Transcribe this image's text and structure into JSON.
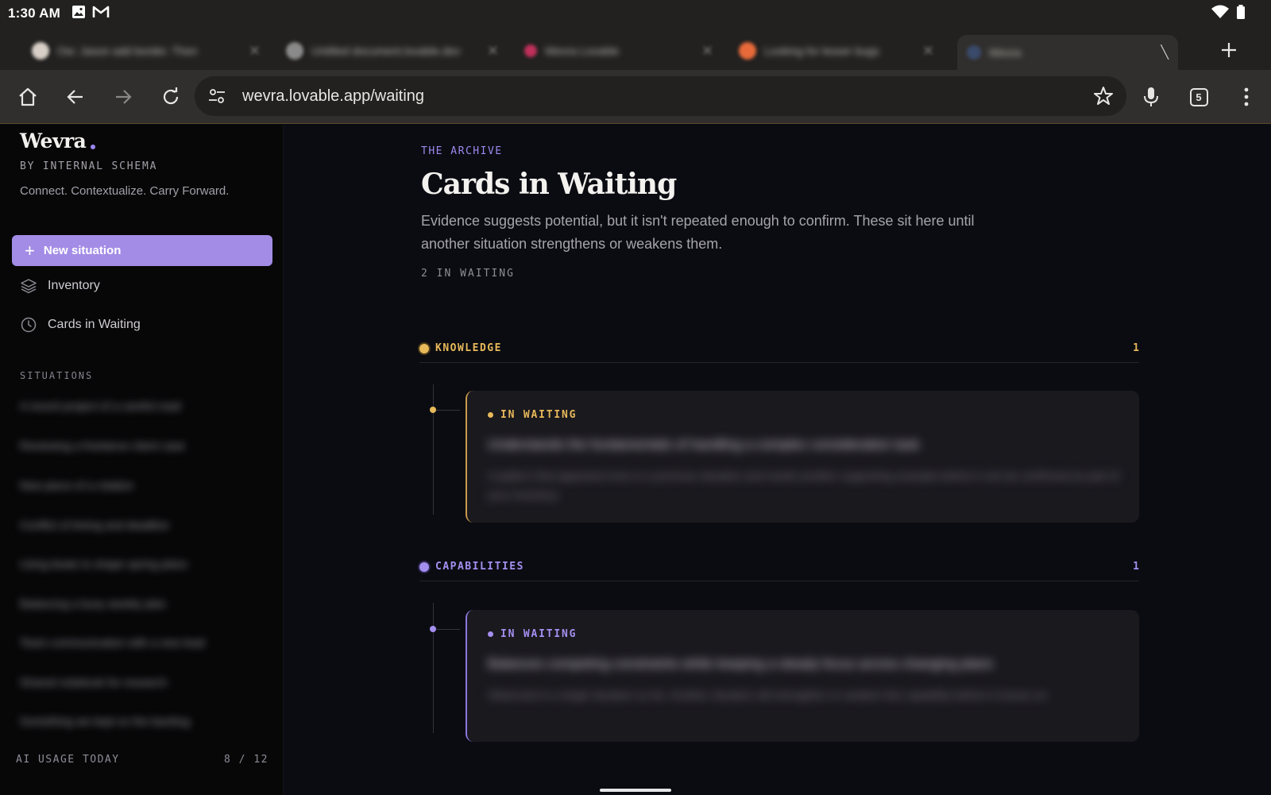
{
  "status_bar": {
    "time": "1:30 AM"
  },
  "browser": {
    "url": "wevra.lovable.app/waiting",
    "tab_count": "5",
    "tabs": [
      {
        "title": "Ow: Jason add border. Then",
        "favicon_color": "#d8d0c8"
      },
      {
        "title": "Untitled document.lovable.dev",
        "favicon_color": "#8a8a8a"
      },
      {
        "title": "Wevra Lovable",
        "favicon_color": "#c0305a"
      },
      {
        "title": "Looking for lesser bugs",
        "favicon_color": "#e86a3a"
      },
      {
        "title": "Wevra",
        "favicon_color": "#3a4a6a"
      }
    ]
  },
  "sidebar": {
    "brand": "Wevra",
    "byline": "BY INTERNAL SCHEMA",
    "tagline": "Connect. Contextualize. Carry Forward.",
    "new_button": "New situation",
    "nav": [
      {
        "label": "Inventory",
        "icon": "layers-icon"
      },
      {
        "label": "Cards in Waiting",
        "icon": "clock-icon"
      }
    ],
    "situations_label": "SITUATIONS",
    "situations": [
      "A recent project of a careful read",
      "Reviewing a freelance client case",
      "New piece of a rotation",
      "Conflict of timing and deadline",
      "Using beats to shape spring plans",
      "Balancing a busy weekly plan",
      "Team communication with a new lead",
      "Shared notebook for research",
      "Something we kept on the backlog"
    ],
    "usage_label": "AI USAGE TODAY",
    "usage_value": "8 / 12"
  },
  "main": {
    "eyebrow": "THE ARCHIVE",
    "title": "Cards in Waiting",
    "description": "Evidence suggests potential, but it isn't repeated enough to confirm. These sit here until another situation strengthens or weakens them.",
    "count_label": "2 IN WAITING",
    "groups": [
      {
        "name": "KNOWLEDGE",
        "count": "1",
        "color": "#e8b95a",
        "card": {
          "status": "IN WAITING",
          "title": "Understands the fundamentals of handling a complex consideration task",
          "body": "A pattern that appeared once in a previous situation and needs another supporting example before it can be confirmed as part of your inventory."
        }
      },
      {
        "name": "CAPABILITIES",
        "count": "1",
        "color": "#a48ff0",
        "card": {
          "status": "IN WAITING",
          "title": "Balances competing constraints while keeping a steady focus across changing plans",
          "body": "Observed in a single situation so far. Another situation will strengthen or weaken this capability before it moves on."
        }
      }
    ]
  }
}
